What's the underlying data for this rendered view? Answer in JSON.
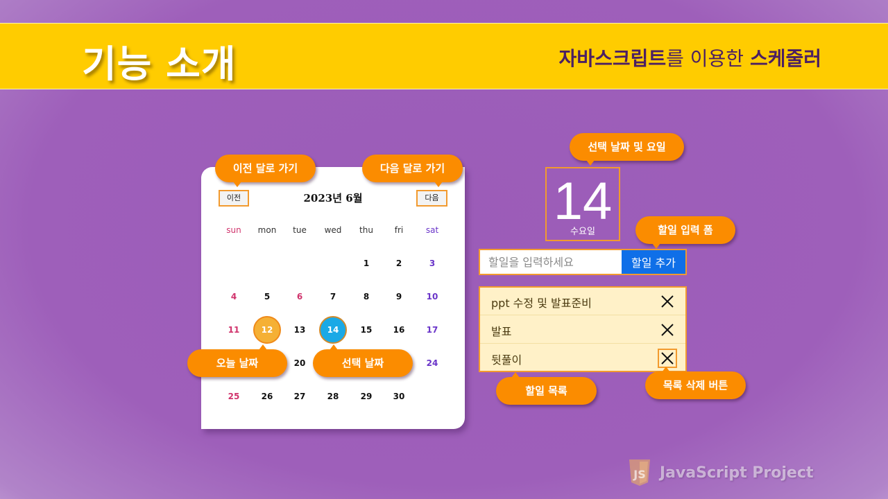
{
  "banner": {
    "title": "기능 소개",
    "sub_part1": "자바스크립트",
    "sub_part2": "를 이용한 ",
    "sub_part3": "스케줄러"
  },
  "calendar": {
    "prev_label": "이전",
    "next_label": "다음",
    "title": "2023년 6월",
    "weekdays": [
      "sun",
      "mon",
      "tue",
      "wed",
      "thu",
      "fri",
      "sat"
    ],
    "weeks": [
      [
        "",
        "",
        "",
        "",
        "1",
        "2",
        "3"
      ],
      [
        "4",
        "5",
        "6",
        "7",
        "8",
        "9",
        "10"
      ],
      [
        "11",
        "12",
        "13",
        "14",
        "15",
        "16",
        "17"
      ],
      [
        "",
        "",
        "20",
        "",
        "",
        "",
        "24"
      ],
      [
        "25",
        "26",
        "27",
        "28",
        "29",
        "30",
        ""
      ]
    ],
    "today": "12",
    "selected": "14"
  },
  "date_display": {
    "number": "14",
    "day": "수요일"
  },
  "todo_form": {
    "placeholder": "할일을 입력하세요",
    "add_label": "할일 추가"
  },
  "todo_list": {
    "items": [
      "ppt 수정 및 발표준비",
      "발표",
      "뒷풀이"
    ]
  },
  "callouts": {
    "prev_month": "이전 달로 가기",
    "next_month": "다음 달로 가기",
    "selected_date_day": "선택 날짜 및 요일",
    "todo_form": "할일 입력 폼",
    "today": "오늘 날짜",
    "selected_date": "선택 날짜",
    "todo_list": "할일 목록",
    "delete_button": "목록 삭제 버튼"
  },
  "footer": {
    "text": "JavaScript Project",
    "logo_icon": "js-shield-icon"
  },
  "colors": {
    "banner": "#ffcc00",
    "accent_orange": "#fb8c00",
    "selected_blue": "#1aa9e6",
    "add_button_blue": "#0f6fe8",
    "sunday": "#d0336c",
    "saturday": "#6a35c9"
  }
}
